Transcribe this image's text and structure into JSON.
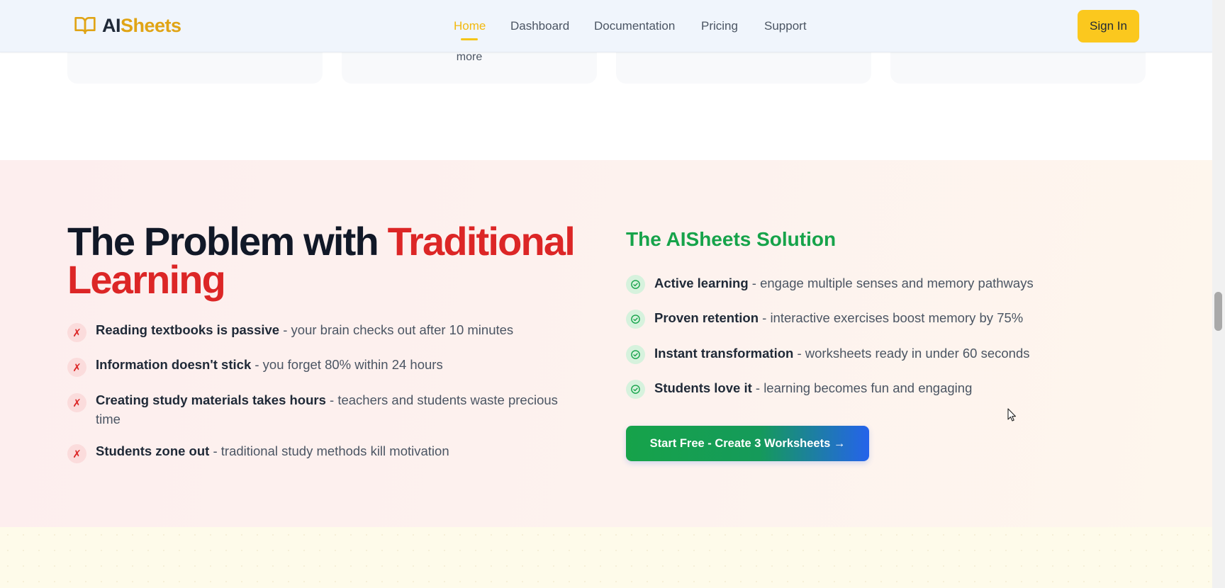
{
  "cards": {
    "more_text": "more"
  },
  "header": {
    "logo_ai": "AI",
    "logo_sheets": "Sheets",
    "nav": [
      {
        "label": "Home",
        "active": true
      },
      {
        "label": "Dashboard",
        "active": false
      },
      {
        "label": "Documentation",
        "active": false
      },
      {
        "label": "Pricing",
        "active": false
      },
      {
        "label": "Support",
        "active": false
      }
    ],
    "signin_label": "Sign In"
  },
  "problem": {
    "title_part1": "The Problem with ",
    "title_highlight": "Traditional Learning",
    "items": [
      {
        "bold": "Reading textbooks is passive",
        "rest": " - your brain checks out after 10 minutes"
      },
      {
        "bold": "Information doesn't stick",
        "rest": " - you forget 80% within 24 hours"
      },
      {
        "bold": "Creating study materials takes hours",
        "rest": " - teachers and students waste precious time"
      },
      {
        "bold": "Students zone out",
        "rest": " - traditional study methods kill motivation"
      }
    ],
    "x_glyph": "✗"
  },
  "solution": {
    "title": "The AISheets Solution",
    "items": [
      {
        "bold": "Active learning",
        "rest": " - engage multiple senses and memory pathways"
      },
      {
        "bold": "Proven retention",
        "rest": " - interactive exercises boost memory by 75%"
      },
      {
        "bold": "Instant transformation",
        "rest": " - worksheets ready in under 60 seconds"
      },
      {
        "bold": "Students love it",
        "rest": " - learning becomes fun and engaging"
      }
    ],
    "cta_label": "Start Free - Create 3 Worksheets →"
  },
  "colors": {
    "brand_yellow": "#fbc81e",
    "problem_red": "#dc2626",
    "solution_green": "#16a34a",
    "cta_blue": "#2563eb"
  },
  "icons": {
    "logo": "open-book-icon",
    "problem_marker": "x-mark-icon",
    "solution_marker": "check-circle-icon",
    "cta_arrow": "arrow-right-icon"
  }
}
